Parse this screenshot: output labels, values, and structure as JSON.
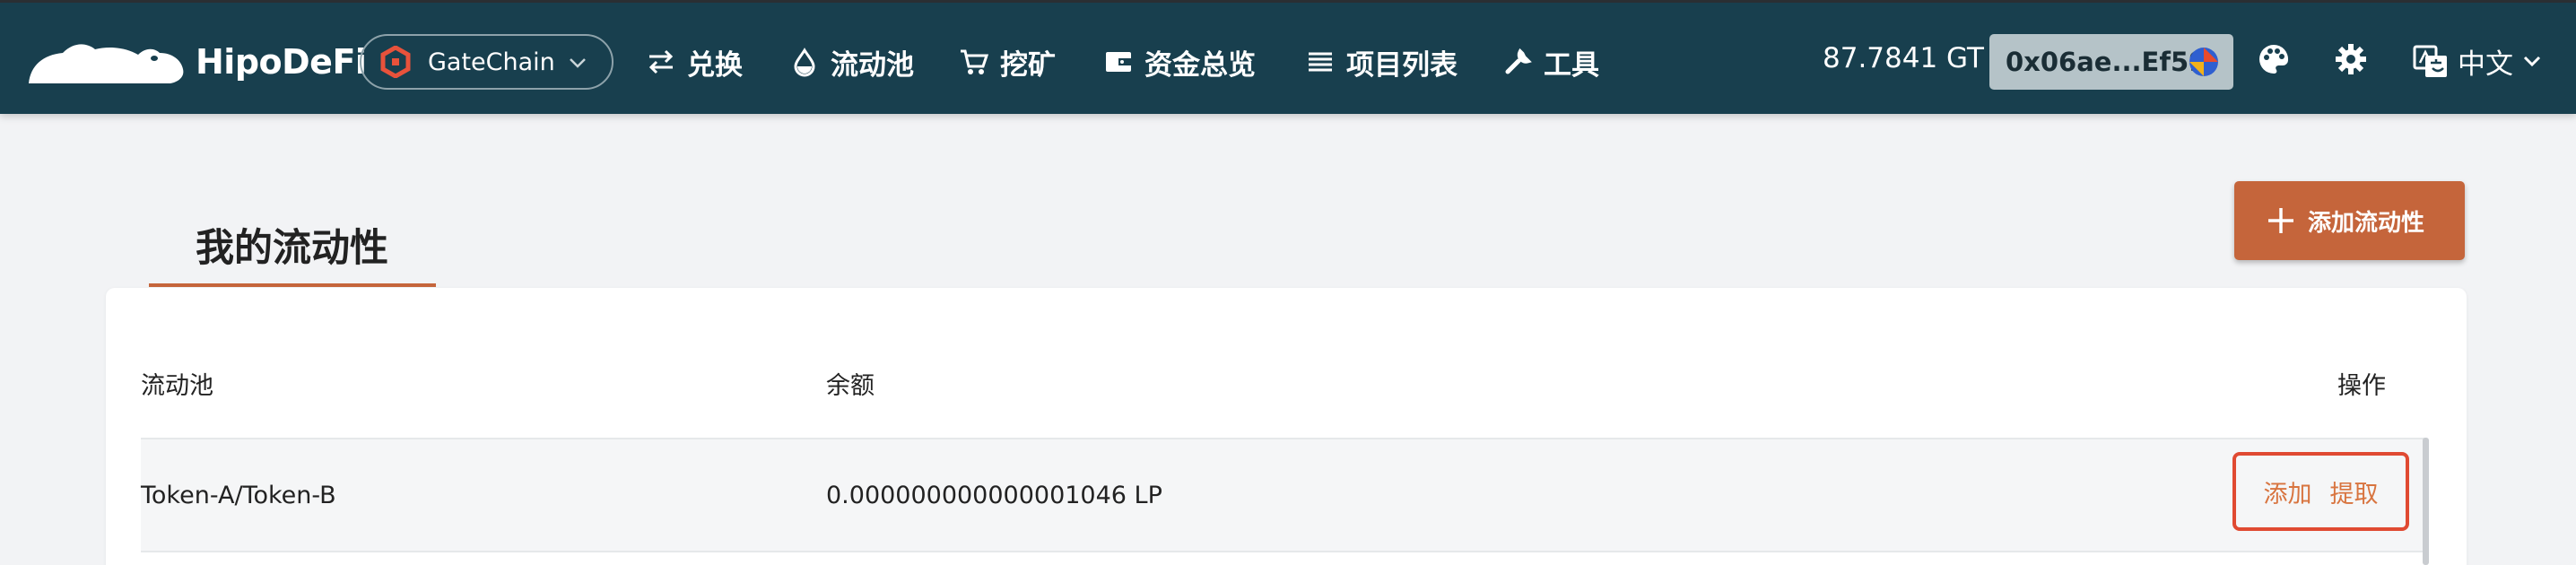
{
  "brand": {
    "name": "HipoDeFi",
    "logo_icon": "hippo-logo-icon"
  },
  "chain": {
    "name": "GateChain",
    "icon": "gatechain-icon"
  },
  "nav": [
    {
      "label": "兑换",
      "icon": "swap-icon"
    },
    {
      "label": "流动池",
      "icon": "drop-icon"
    },
    {
      "label": "挖矿",
      "icon": "cart-icon"
    },
    {
      "label": "资金总览",
      "icon": "wallet-icon"
    },
    {
      "label": "项目列表",
      "icon": "list-icon"
    },
    {
      "label": "工具",
      "icon": "wrench-icon"
    }
  ],
  "account": {
    "balance": "87.7841 GT",
    "address": "0x06ae...Ef59"
  },
  "language": {
    "label": "中文"
  },
  "page": {
    "title": "我的流动性",
    "add_button": "添加流动性"
  },
  "table": {
    "headers": {
      "pool": "流动池",
      "balance": "余额",
      "action": "操作"
    },
    "rows": [
      {
        "pool": "Token-A/Token-B",
        "balance": "0.000000000000001046 LP",
        "add": "添加",
        "withdraw": "提取"
      }
    ]
  },
  "colors": {
    "topbar": "#183f4e",
    "accent": "#c5653b",
    "highlight_border": "#e04a32",
    "background": "#f2f3f5"
  }
}
